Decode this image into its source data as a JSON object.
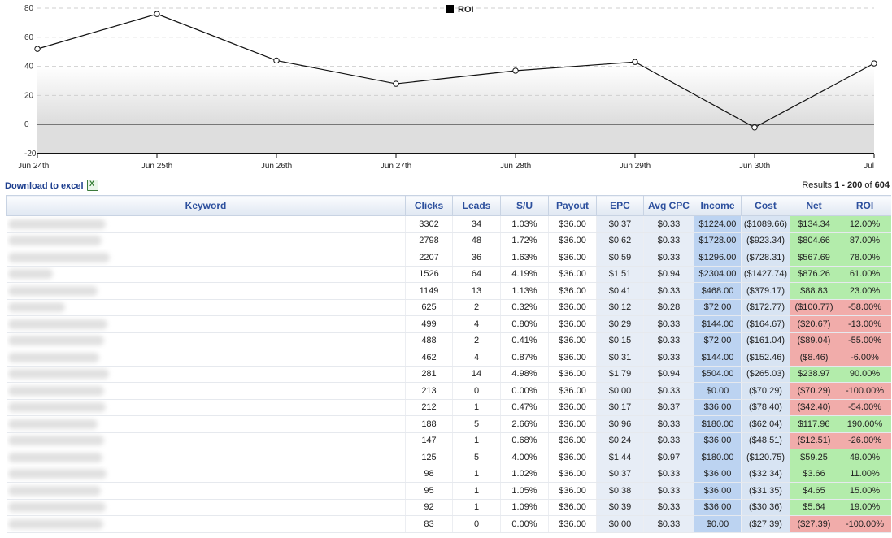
{
  "chart_data": {
    "type": "line",
    "legend": "ROI",
    "legend_position": "top-center",
    "x": [
      "Jun 24th",
      "Jun 25th",
      "Jun 26th",
      "Jun 27th",
      "Jun 28th",
      "Jun 29th",
      "Jun 30th",
      "Jul"
    ],
    "series": [
      {
        "name": "ROI",
        "values": [
          52,
          76,
          44,
          28,
          37,
          43,
          -2,
          42
        ]
      }
    ],
    "ylim": [
      -20,
      80
    ],
    "yticks": [
      -20,
      0,
      20,
      40,
      60,
      80
    ],
    "grid": true
  },
  "toolbar": {
    "download_label": "Download to excel",
    "results_prefix": "Results ",
    "results_range": "1 - 200",
    "results_mid": " of ",
    "results_total": "604"
  },
  "table": {
    "headers": {
      "keyword": "Keyword",
      "clicks": "Clicks",
      "leads": "Leads",
      "su": "S/U",
      "payout": "Payout",
      "epc": "EPC",
      "avgcpc": "Avg CPC",
      "income": "Income",
      "cost": "Cost",
      "net": "Net",
      "roi": "ROI"
    },
    "rows": [
      {
        "clicks": "3302",
        "leads": "34",
        "su": "1.03%",
        "payout": "$36.00",
        "epc": "$0.37",
        "avgcpc": "$0.33",
        "income": "$1224.00",
        "cost": "($1089.66)",
        "net": "$134.34",
        "roi": "12.00%",
        "status": "pos"
      },
      {
        "clicks": "2798",
        "leads": "48",
        "su": "1.72%",
        "payout": "$36.00",
        "epc": "$0.62",
        "avgcpc": "$0.33",
        "income": "$1728.00",
        "cost": "($923.34)",
        "net": "$804.66",
        "roi": "87.00%",
        "status": "pos"
      },
      {
        "clicks": "2207",
        "leads": "36",
        "su": "1.63%",
        "payout": "$36.00",
        "epc": "$0.59",
        "avgcpc": "$0.33",
        "income": "$1296.00",
        "cost": "($728.31)",
        "net": "$567.69",
        "roi": "78.00%",
        "status": "pos"
      },
      {
        "clicks": "1526",
        "leads": "64",
        "su": "4.19%",
        "payout": "$36.00",
        "epc": "$1.51",
        "avgcpc": "$0.94",
        "income": "$2304.00",
        "cost": "($1427.74)",
        "net": "$876.26",
        "roi": "61.00%",
        "status": "pos"
      },
      {
        "clicks": "1149",
        "leads": "13",
        "su": "1.13%",
        "payout": "$36.00",
        "epc": "$0.41",
        "avgcpc": "$0.33",
        "income": "$468.00",
        "cost": "($379.17)",
        "net": "$88.83",
        "roi": "23.00%",
        "status": "pos"
      },
      {
        "clicks": "625",
        "leads": "2",
        "su": "0.32%",
        "payout": "$36.00",
        "epc": "$0.12",
        "avgcpc": "$0.28",
        "income": "$72.00",
        "cost": "($172.77)",
        "net": "($100.77)",
        "roi": "-58.00%",
        "status": "neg"
      },
      {
        "clicks": "499",
        "leads": "4",
        "su": "0.80%",
        "payout": "$36.00",
        "epc": "$0.29",
        "avgcpc": "$0.33",
        "income": "$144.00",
        "cost": "($164.67)",
        "net": "($20.67)",
        "roi": "-13.00%",
        "status": "neg"
      },
      {
        "clicks": "488",
        "leads": "2",
        "su": "0.41%",
        "payout": "$36.00",
        "epc": "$0.15",
        "avgcpc": "$0.33",
        "income": "$72.00",
        "cost": "($161.04)",
        "net": "($89.04)",
        "roi": "-55.00%",
        "status": "neg"
      },
      {
        "clicks": "462",
        "leads": "4",
        "su": "0.87%",
        "payout": "$36.00",
        "epc": "$0.31",
        "avgcpc": "$0.33",
        "income": "$144.00",
        "cost": "($152.46)",
        "net": "($8.46)",
        "roi": "-6.00%",
        "status": "neg"
      },
      {
        "clicks": "281",
        "leads": "14",
        "su": "4.98%",
        "payout": "$36.00",
        "epc": "$1.79",
        "avgcpc": "$0.94",
        "income": "$504.00",
        "cost": "($265.03)",
        "net": "$238.97",
        "roi": "90.00%",
        "status": "pos"
      },
      {
        "clicks": "213",
        "leads": "0",
        "su": "0.00%",
        "payout": "$36.00",
        "epc": "$0.00",
        "avgcpc": "$0.33",
        "income": "$0.00",
        "cost": "($70.29)",
        "net": "($70.29)",
        "roi": "-100.00%",
        "status": "neg"
      },
      {
        "clicks": "212",
        "leads": "1",
        "su": "0.47%",
        "payout": "$36.00",
        "epc": "$0.17",
        "avgcpc": "$0.37",
        "income": "$36.00",
        "cost": "($78.40)",
        "net": "($42.40)",
        "roi": "-54.00%",
        "status": "neg"
      },
      {
        "clicks": "188",
        "leads": "5",
        "su": "2.66%",
        "payout": "$36.00",
        "epc": "$0.96",
        "avgcpc": "$0.33",
        "income": "$180.00",
        "cost": "($62.04)",
        "net": "$117.96",
        "roi": "190.00%",
        "status": "pos"
      },
      {
        "clicks": "147",
        "leads": "1",
        "su": "0.68%",
        "payout": "$36.00",
        "epc": "$0.24",
        "avgcpc": "$0.33",
        "income": "$36.00",
        "cost": "($48.51)",
        "net": "($12.51)",
        "roi": "-26.00%",
        "status": "neg"
      },
      {
        "clicks": "125",
        "leads": "5",
        "su": "4.00%",
        "payout": "$36.00",
        "epc": "$1.44",
        "avgcpc": "$0.97",
        "income": "$180.00",
        "cost": "($120.75)",
        "net": "$59.25",
        "roi": "49.00%",
        "status": "pos"
      },
      {
        "clicks": "98",
        "leads": "1",
        "su": "1.02%",
        "payout": "$36.00",
        "epc": "$0.37",
        "avgcpc": "$0.33",
        "income": "$36.00",
        "cost": "($32.34)",
        "net": "$3.66",
        "roi": "11.00%",
        "status": "pos"
      },
      {
        "clicks": "95",
        "leads": "1",
        "su": "1.05%",
        "payout": "$36.00",
        "epc": "$0.38",
        "avgcpc": "$0.33",
        "income": "$36.00",
        "cost": "($31.35)",
        "net": "$4.65",
        "roi": "15.00%",
        "status": "pos"
      },
      {
        "clicks": "92",
        "leads": "1",
        "su": "1.09%",
        "payout": "$36.00",
        "epc": "$0.39",
        "avgcpc": "$0.33",
        "income": "$36.00",
        "cost": "($30.36)",
        "net": "$5.64",
        "roi": "19.00%",
        "status": "pos"
      },
      {
        "clicks": "83",
        "leads": "0",
        "su": "0.00%",
        "payout": "$36.00",
        "epc": "$0.00",
        "avgcpc": "$0.33",
        "income": "$0.00",
        "cost": "($27.39)",
        "net": "($27.39)",
        "roi": "-100.00%",
        "status": "neg"
      }
    ]
  }
}
